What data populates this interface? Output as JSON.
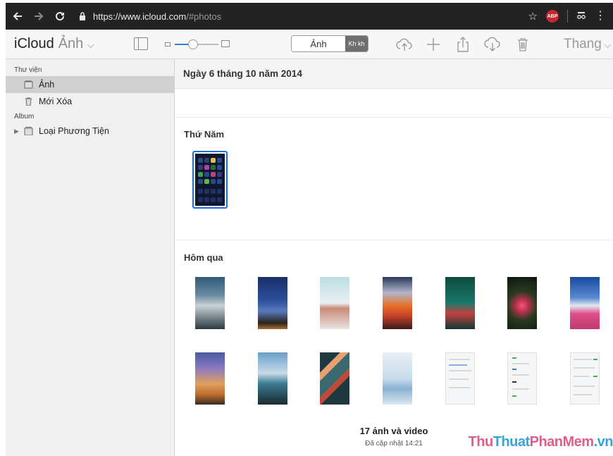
{
  "browser": {
    "back_icon": "arrow-left-icon",
    "forward_icon": "arrow-right-icon",
    "reload_icon": "reload-icon",
    "url_host": "https://www.icloud.com",
    "url_path": "/#photos",
    "abp_label": "ABP"
  },
  "toolbar": {
    "brand": "iCloud",
    "app_name": "Ảnh",
    "segment_label": "Ảnh",
    "segment_other": "Kh kh",
    "sort_label": "Thang"
  },
  "sidebar": {
    "library_header": "Thư viện",
    "items": [
      {
        "label": "Ảnh",
        "icon": "photos-icon",
        "active": true
      },
      {
        "label": "Mới Xóa",
        "icon": "trash-icon",
        "active": false
      }
    ],
    "album_header": "Album",
    "albums": [
      {
        "label": "Loại Phương Tiện",
        "icon": "album-icon"
      }
    ]
  },
  "main": {
    "date_header": "Ngày 6 tháng 10 năm 2014",
    "groups": [
      {
        "title": "Thứ Năm",
        "count": 1
      },
      {
        "title": "Hôm qua",
        "count": 14
      }
    ],
    "footer_count": "17 ảnh và video",
    "footer_updated": "Đã cập nhật 14:21"
  },
  "watermark": {
    "part1": "Thu",
    "part2": "Thuat",
    "part3": "PhanMem",
    "part4": ".vn"
  },
  "colors": {
    "accent": "#1c6fe0",
    "toolbar_bg": "#f7f7f7",
    "sidebar_bg": "#f0f0f0",
    "browser_bg": "#232323"
  }
}
